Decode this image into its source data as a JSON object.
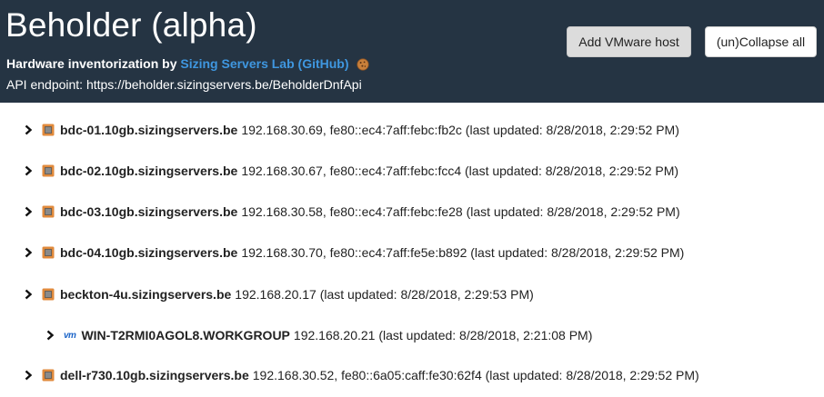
{
  "header": {
    "title": "Beholder (alpha)",
    "subtitle_prefix": "Hardware inventorization by",
    "subtitle_link": "Sizing Servers Lab (GitHub)",
    "api_label": "API endpoint:",
    "api_url": "https://beholder.sizingservers.be/BeholderDnfApi",
    "add_button": "Add VMware host",
    "collapse_button": "(un)Collapse all",
    "background_color": "#253443",
    "link_color": "#3f97e0"
  },
  "hosts": [
    {
      "icon": "server-icon",
      "name": "bdc-01.10gb.sizingservers.be",
      "details": "192.168.30.69, fe80::ec4:7aff:febc:fb2c (last updated: 8/28/2018, 2:29:52 PM)"
    },
    {
      "icon": "server-icon",
      "name": "bdc-02.10gb.sizingservers.be",
      "details": "192.168.30.67, fe80::ec4:7aff:febc:fcc4 (last updated: 8/28/2018, 2:29:52 PM)"
    },
    {
      "icon": "server-icon",
      "name": "bdc-03.10gb.sizingservers.be",
      "details": "192.168.30.58, fe80::ec4:7aff:febc:fe28 (last updated: 8/28/2018, 2:29:52 PM)"
    },
    {
      "icon": "server-icon",
      "name": "bdc-04.10gb.sizingservers.be",
      "details": "192.168.30.70, fe80::ec4:7aff:fe5e:b892 (last updated: 8/28/2018, 2:29:52 PM)"
    },
    {
      "icon": "server-icon",
      "name": "beckton-4u.sizingservers.be",
      "details": "192.168.20.17 (last updated: 8/28/2018, 2:29:53 PM)"
    },
    {
      "icon": "vm-icon",
      "icon_text": "vm",
      "name": "WIN-T2RMI0AGOL8.WORKGROUP",
      "details": "192.168.20.21 (last updated: 8/28/2018, 2:21:08 PM)"
    },
    {
      "icon": "server-icon",
      "name": "dell-r730.10gb.sizingservers.be",
      "details": "192.168.30.52, fe80::6a05:caff:fe30:62f4 (last updated: 8/28/2018, 2:29:52 PM)"
    }
  ]
}
